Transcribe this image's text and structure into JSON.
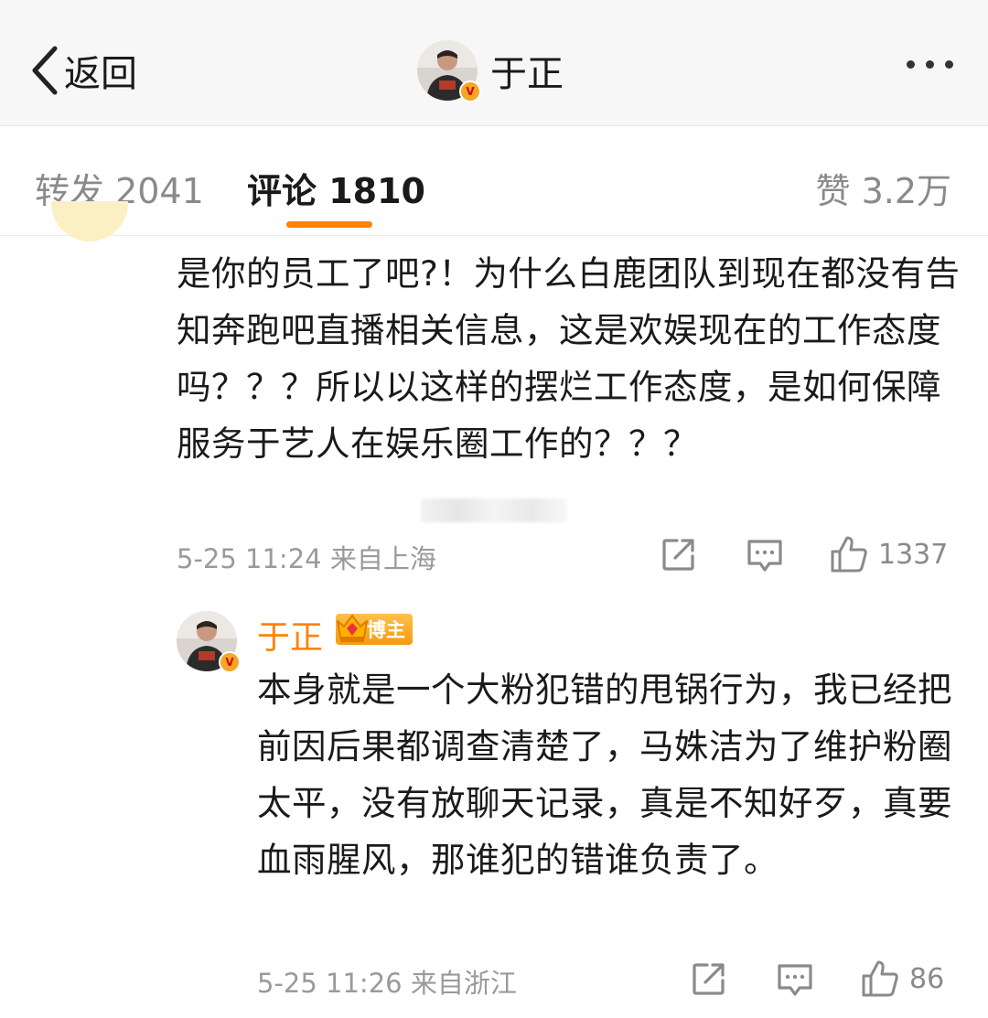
{
  "header": {
    "back_label": "返回",
    "title": "于正",
    "verified_badge": "V"
  },
  "tabs": [
    {
      "label": "转发 2041",
      "active": false
    },
    {
      "label": "评论 1810",
      "active": true
    },
    {
      "label": "赞 3.2万",
      "active": false
    }
  ],
  "comment": {
    "text": "是你的员工了吧?！为什么白鹿团队到现在都没有告知奔跑吧直播相关信息，这是欢娱现在的工作态度吗？？？所以以这样的摆烂工作态度，是如何保障服务于艺人在娱乐圈工作的？？？",
    "time_location": "5-25 11:24  来自上海",
    "like_count": "1337"
  },
  "reply": {
    "author": "于正",
    "badge_label": "博主",
    "text": "本身就是一个大粉犯错的甩锅行为，我已经把前因后果都调查清楚了，马姝洁为了维护粉圈太平，没有放聊天记录，真是不知好歹，真要血雨腥风，那谁犯的错谁负责了。",
    "time_location": "5-25 11:26  来自浙江",
    "like_count": "86"
  },
  "colors": {
    "accent": "#ff8200",
    "header_bg": "#f7f7f7",
    "muted_text": "#9a9a9a"
  },
  "icons": [
    "back-chevron-icon",
    "more-dots-icon",
    "share-icon",
    "comment-icon",
    "like-icon",
    "crown-icon",
    "verified-icon"
  ]
}
